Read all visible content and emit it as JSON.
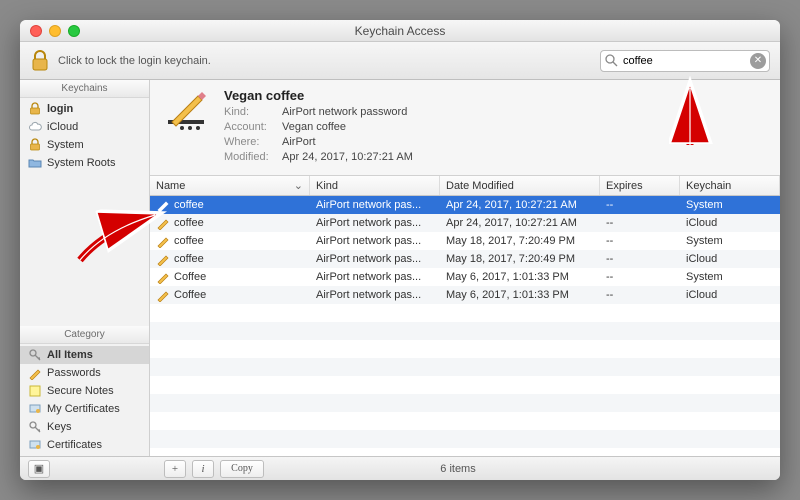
{
  "window_title": "Keychain Access",
  "toolbar": {
    "lock_text": "Click to lock the login keychain."
  },
  "search": {
    "value": "coffee",
    "placeholder": "Search"
  },
  "sidebar": {
    "keychains_header": "Keychains",
    "keychains": [
      {
        "label": "login",
        "icon": "lock-small-orange",
        "selected": true
      },
      {
        "label": "iCloud",
        "icon": "cloud",
        "selected": false
      },
      {
        "label": "System",
        "icon": "lock-small-orange",
        "selected": false
      },
      {
        "label": "System Roots",
        "icon": "folder",
        "selected": false
      }
    ],
    "category_header": "Category",
    "categories": [
      {
        "label": "All Items",
        "icon": "key",
        "selected": true
      },
      {
        "label": "Passwords",
        "icon": "pencil",
        "selected": false
      },
      {
        "label": "Secure Notes",
        "icon": "note",
        "selected": false
      },
      {
        "label": "My Certificates",
        "icon": "cert",
        "selected": false
      },
      {
        "label": "Keys",
        "icon": "key",
        "selected": false
      },
      {
        "label": "Certificates",
        "icon": "cert",
        "selected": false
      }
    ]
  },
  "detail": {
    "title": "Vegan coffee",
    "kind_label": "Kind:",
    "kind": "AirPort network password",
    "account_label": "Account:",
    "account": "Vegan coffee",
    "where_label": "Where:",
    "where": "AirPort",
    "modified_label": "Modified:",
    "modified": "Apr 24, 2017, 10:27:21 AM"
  },
  "columns": {
    "name": "Name",
    "kind": "Kind",
    "date": "Date Modified",
    "expires": "Expires",
    "keychain": "Keychain"
  },
  "rows": [
    {
      "name": "coffee",
      "kind": "AirPort network pas...",
      "date": "Apr 24, 2017, 10:27:21 AM",
      "expires": "--",
      "keychain": "System",
      "selected": true
    },
    {
      "name": "coffee",
      "kind": "AirPort network pas...",
      "date": "Apr 24, 2017, 10:27:21 AM",
      "expires": "--",
      "keychain": "iCloud",
      "selected": false
    },
    {
      "name": "coffee",
      "kind": "AirPort network pas...",
      "date": "May 18, 2017, 7:20:49 PM",
      "expires": "--",
      "keychain": "System",
      "selected": false
    },
    {
      "name": "coffee",
      "kind": "AirPort network pas...",
      "date": "May 18, 2017, 7:20:49 PM",
      "expires": "--",
      "keychain": "iCloud",
      "selected": false
    },
    {
      "name": "Coffee",
      "kind": "AirPort network pas...",
      "date": "May 6, 2017, 1:01:33 PM",
      "expires": "--",
      "keychain": "System",
      "selected": false
    },
    {
      "name": "Coffee",
      "kind": "AirPort network pas...",
      "date": "May 6, 2017, 1:01:33 PM",
      "expires": "--",
      "keychain": "iCloud",
      "selected": false
    }
  ],
  "statusbar": {
    "item_count": "6 items",
    "copy_label": "Copy"
  }
}
